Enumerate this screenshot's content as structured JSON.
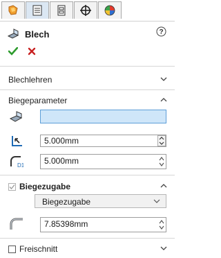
{
  "tabs": [
    {
      "name": "feature-manager",
      "icon": "orange-feature-icon"
    },
    {
      "name": "property-manager",
      "icon": "property-list-icon",
      "active": true
    },
    {
      "name": "configuration-manager",
      "icon": "configuration-icon"
    },
    {
      "name": "dimxpert",
      "icon": "crosshair-icon"
    },
    {
      "name": "display-manager",
      "icon": "color-wheel-icon"
    }
  ],
  "panel": {
    "title": "Blech",
    "help_icon": "help-icon"
  },
  "sections": {
    "blechlehren": {
      "label": "Blechlehren"
    },
    "biegeparameter": {
      "label": "Biegeparameter",
      "face_selection_value": "",
      "thickness_value": "5.000mm",
      "radius_value": "5.000mm"
    },
    "biegezugabe": {
      "label": "Biegezugabe",
      "checked": true,
      "dropdown_value": "Biegezugabe",
      "k_factor_value": "7.85398mm"
    },
    "freischnitt": {
      "label": "Freischnitt",
      "checked": false
    }
  },
  "colors": {
    "accent_select": "#cfe6f9",
    "ok_green": "#2d9b2d",
    "cancel_red": "#c82020"
  }
}
